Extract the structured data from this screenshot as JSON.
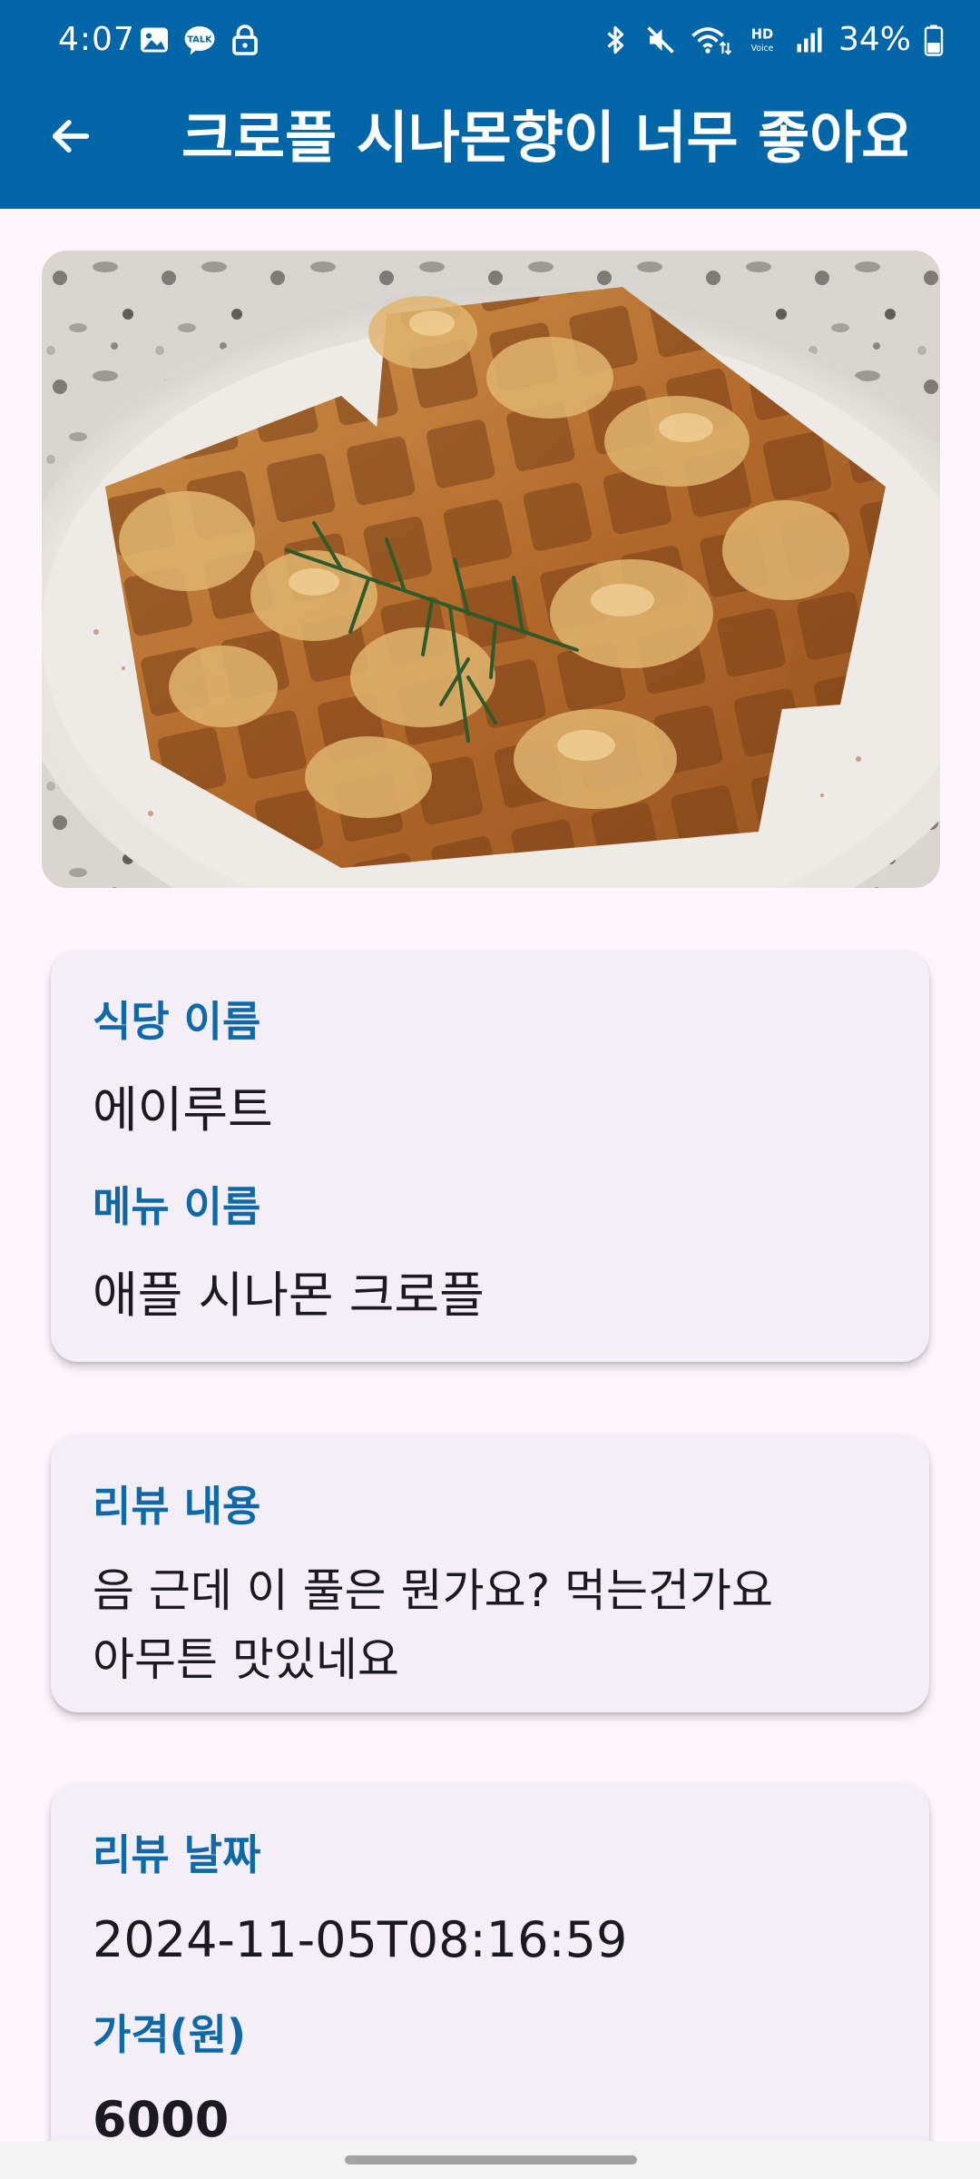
{
  "status_bar": {
    "time": "4:07",
    "battery": "34%",
    "left_icons": [
      "gallery-icon",
      "kakaotalk-icon",
      "lock-icon"
    ],
    "right_icons": [
      "bluetooth-icon",
      "mute-icon",
      "wifi-icon",
      "hd-voice-icon",
      "signal-icon",
      "battery-icon"
    ],
    "hd_text": "HD",
    "voice_text": "Voice",
    "talk_text": "TALK"
  },
  "app_bar": {
    "title": "크로플 시나몬향이 너무 좋아요..",
    "back_icon": "arrow-back-icon",
    "color": "#0066A7"
  },
  "hero_image": {
    "alt": "waffle-photo"
  },
  "details": {
    "restaurant_label": "식당 이름",
    "restaurant_value": "에이루트",
    "menu_label": "메뉴 이름",
    "menu_value": "애플 시나몬 크로플"
  },
  "review": {
    "content_label": "리뷰 내용",
    "content_value": "음 근데 이 풀은 뭔가요? 먹는건가요\n아무튼 맛있네요"
  },
  "meta": {
    "date_label": "리뷰 날짜",
    "date_value": "2024-11-05T08:16:59",
    "price_label": "가격(원)",
    "price_value": "6000"
  },
  "colors": {
    "accent": "#0F69A9",
    "card_bg": "#F4EFF6",
    "page_bg": "#FDF7FD"
  }
}
